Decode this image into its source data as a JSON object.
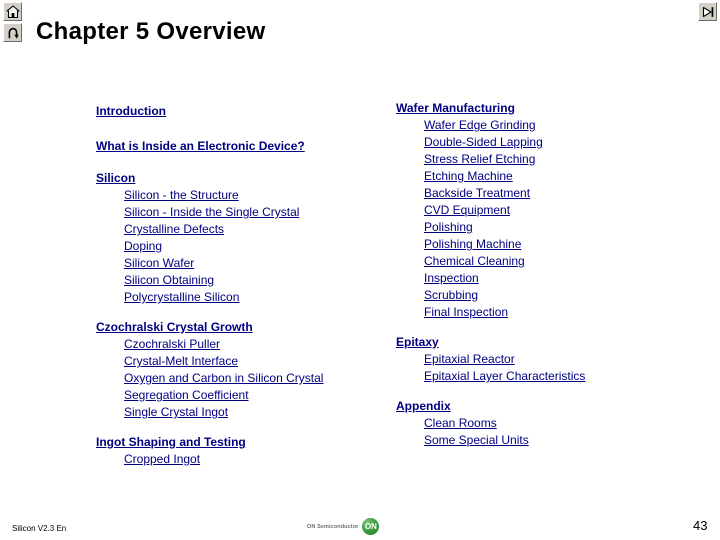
{
  "header": {
    "title": "Chapter 5 Overview"
  },
  "nav": {
    "home": {
      "icon": "home-icon",
      "label": "Home"
    },
    "back": {
      "icon": "u-turn-back-icon",
      "label": "Back"
    },
    "next": {
      "icon": "next-slide-icon",
      "label": "Next"
    }
  },
  "toc": {
    "left": [
      {
        "heading": "Introduction",
        "spacing": "loose",
        "items": []
      },
      {
        "heading": "What is Inside an Electronic Device?",
        "spacing": "loose",
        "items": []
      },
      {
        "heading": "Silicon",
        "spacing": "normal",
        "items": [
          {
            "label": "Silicon - the Structure",
            "rule": true
          },
          {
            "label": "Silicon - Inside the Single Crystal",
            "rule": true
          },
          {
            "label": "Crystalline Defects",
            "rule": true
          },
          {
            "label": "Doping",
            "rule": true
          },
          {
            "label": "Silicon Wafer",
            "rule": true
          },
          {
            "label": "Silicon Obtaining",
            "rule": true
          },
          {
            "label": "Polycrystalline Silicon",
            "rule": true
          }
        ]
      },
      {
        "heading": "Czochralski Crystal Growth",
        "spacing": "normal",
        "items": [
          {
            "label": "Czochralski Puller",
            "rule": false
          },
          {
            "label": "Crystal-Melt Interface",
            "rule": true
          },
          {
            "label": "Oxygen and Carbon in Silicon Crystal",
            "rule": true
          },
          {
            "label": "Segregation Coefficient",
            "rule": true
          },
          {
            "label": "Single Crystal Ingot",
            "rule": true
          }
        ]
      },
      {
        "heading": "Ingot Shaping and Testing",
        "spacing": "normal",
        "items": [
          {
            "label": "Cropped Ingot",
            "rule": true
          }
        ]
      }
    ],
    "right": [
      {
        "heading": "Wafer Manufacturing",
        "spacing": "normal",
        "items": [
          {
            "label": "Wafer Edge Grinding",
            "rule": true
          },
          {
            "label": "Double-Sided Lapping",
            "rule": true
          },
          {
            "label": "Stress Relief Etching",
            "rule": true
          },
          {
            "label": "Etching Machine",
            "rule": true
          },
          {
            "label": "Backside Treatment",
            "rule": true
          },
          {
            "label": "CVD Equipment",
            "rule": true
          },
          {
            "label": "Polishing",
            "rule": true
          },
          {
            "label": "Polishing Machine",
            "rule": true
          },
          {
            "label": "Chemical Cleaning",
            "rule": true
          },
          {
            "label": "Inspection",
            "rule": true
          },
          {
            "label": "Scrubbing",
            "rule": true
          },
          {
            "label": "Final Inspection",
            "rule": true
          }
        ]
      },
      {
        "heading": "Epitaxy",
        "spacing": "normal",
        "items": [
          {
            "label": "Epitaxial Reactor",
            "rule": false
          },
          {
            "label": "Epitaxial Layer Characteristics",
            "rule": true
          }
        ]
      },
      {
        "heading": "Appendix",
        "spacing": "normal",
        "items": [
          {
            "label": "Clean Rooms",
            "rule": false
          },
          {
            "label": "Some Special Units",
            "rule": true
          }
        ]
      }
    ]
  },
  "footer": {
    "version": "Silicon V2.3 En",
    "logo_text": "ON Semiconductor",
    "logo_mark": "ON",
    "page_number": "43"
  },
  "colors": {
    "link": "#000080",
    "title": "#000000",
    "background": "#ffffff",
    "logo_green": "#3f9f40"
  }
}
